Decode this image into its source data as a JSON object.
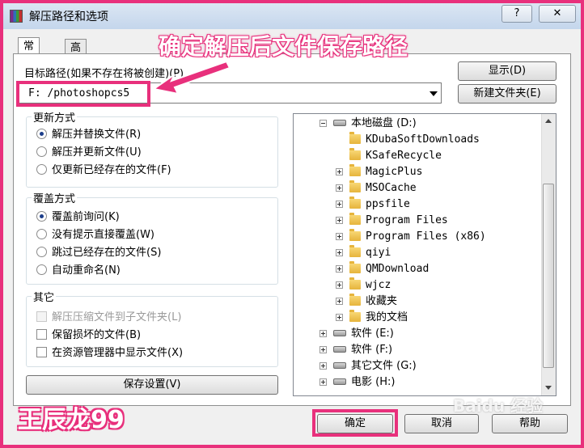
{
  "window": {
    "title": "解压路径和选项",
    "help_btn": "?",
    "close_btn": "✕"
  },
  "tabs": [
    {
      "label": "常规",
      "active": true
    },
    {
      "label": "高级",
      "active": false
    }
  ],
  "target_path": {
    "label": "目标路径(如果不存在将被创建)(P)",
    "value": "F: /photoshopcs5"
  },
  "buttons": {
    "display": "显示(D)",
    "new_folder": "新建文件夹(E)",
    "save_settings": "保存设置(V)",
    "ok": "确定",
    "cancel": "取消",
    "help": "帮助"
  },
  "update_mode": {
    "title": "更新方式",
    "options": [
      {
        "label": "解压并替换文件(R)",
        "selected": true
      },
      {
        "label": "解压并更新文件(U)",
        "selected": false
      },
      {
        "label": "仅更新已经存在的文件(F)",
        "selected": false
      }
    ]
  },
  "overwrite_mode": {
    "title": "覆盖方式",
    "options": [
      {
        "label": "覆盖前询问(K)",
        "selected": true
      },
      {
        "label": "没有提示直接覆盖(W)",
        "selected": false
      },
      {
        "label": "跳过已经存在的文件(S)",
        "selected": false
      },
      {
        "label": "自动重命名(N)",
        "selected": false
      }
    ]
  },
  "other": {
    "title": "其它",
    "options": [
      {
        "label": "解压压缩文件到子文件夹(L)",
        "checked": false,
        "disabled": true
      },
      {
        "label": "保留损坏的文件(B)",
        "checked": false,
        "disabled": false
      },
      {
        "label": "在资源管理器中显示文件(X)",
        "checked": false,
        "disabled": false
      }
    ]
  },
  "tree": {
    "items": [
      {
        "label": "本地磁盘 (D:)",
        "level": 0,
        "icon": "drive-icon",
        "expander": "minus"
      },
      {
        "label": "KDubaSoftDownloads",
        "level": 1,
        "icon": "folder-icon",
        "expander": "none"
      },
      {
        "label": "KSafeRecycle",
        "level": 1,
        "icon": "folder-icon",
        "expander": "none"
      },
      {
        "label": "MagicPlus",
        "level": 1,
        "icon": "folder-icon",
        "expander": "plus"
      },
      {
        "label": "MSOCache",
        "level": 1,
        "icon": "folder-icon",
        "expander": "plus"
      },
      {
        "label": "ppsfile",
        "level": 1,
        "icon": "folder-icon",
        "expander": "plus"
      },
      {
        "label": "Program Files",
        "level": 1,
        "icon": "folder-icon",
        "expander": "plus"
      },
      {
        "label": "Program Files (x86)",
        "level": 1,
        "icon": "folder-icon",
        "expander": "plus"
      },
      {
        "label": "qiyi",
        "level": 1,
        "icon": "folder-icon",
        "expander": "plus"
      },
      {
        "label": "QMDownload",
        "level": 1,
        "icon": "folder-icon",
        "expander": "plus"
      },
      {
        "label": "wjcz",
        "level": 1,
        "icon": "folder-icon",
        "expander": "plus"
      },
      {
        "label": "收藏夹",
        "level": 1,
        "icon": "favorites-folder-icon",
        "expander": "plus"
      },
      {
        "label": "我的文档",
        "level": 1,
        "icon": "folder-icon",
        "expander": "plus"
      },
      {
        "label": "软件 (E:)",
        "level": 0,
        "icon": "drive-icon",
        "expander": "plus"
      },
      {
        "label": "软件 (F:)",
        "level": 0,
        "icon": "drive-icon",
        "expander": "plus"
      },
      {
        "label": "其它文件 (G:)",
        "level": 0,
        "icon": "drive-icon",
        "expander": "plus"
      },
      {
        "label": "电影 (H:)",
        "level": 0,
        "icon": "drive-icon",
        "expander": "plus"
      }
    ]
  },
  "annotation": {
    "text": "确定解压后文件保存路径"
  },
  "watermark": {
    "author": "王辰龙99",
    "site": "Baidu 经验"
  },
  "colors": {
    "highlight": "#e8307c"
  }
}
